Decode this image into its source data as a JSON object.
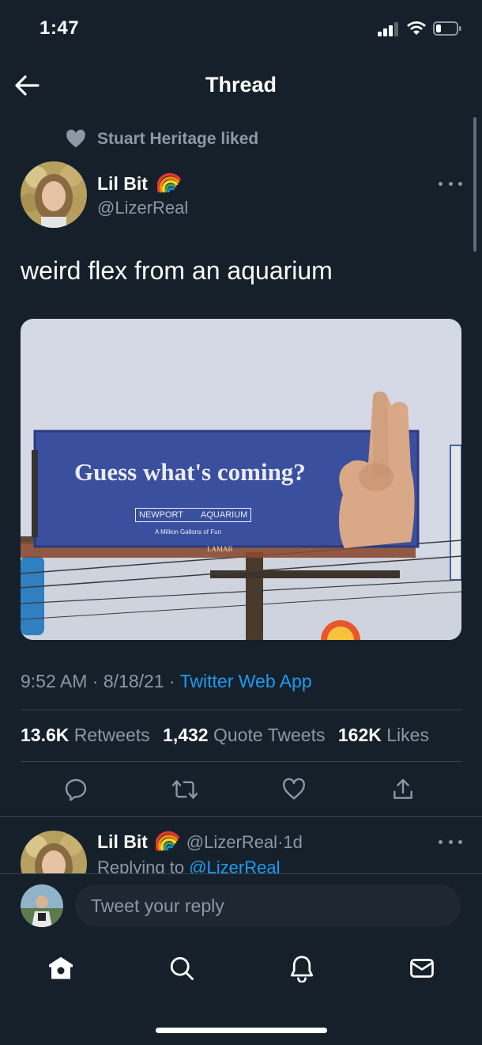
{
  "status_bar": {
    "time": "1:47"
  },
  "header": {
    "title": "Thread",
    "back_icon": "arrow-left-icon"
  },
  "social_context": {
    "text": "Stuart Heritage liked",
    "icon": "heart-icon"
  },
  "tweet": {
    "author_name": "Lil Bit",
    "author_handle": "@LizerReal",
    "text": "weird flex from an aquarium",
    "media": {
      "headline": "Guess what's coming?",
      "brand_left": "NEWPORT",
      "brand_right": "AQUARIUM",
      "tagline": "A Million Gallons of Fun",
      "operator": "LAMAR"
    },
    "time": "9:52 AM",
    "date": "8/18/21",
    "source": "Twitter Web App",
    "separator": "·",
    "stats": {
      "retweets_count": "13.6K",
      "retweets_label": "Retweets",
      "quotes_count": "1,432",
      "quotes_label": "Quote Tweets",
      "likes_count": "162K",
      "likes_label": "Likes"
    }
  },
  "reply_preview": {
    "author_name": "Lil Bit",
    "author_handle": "@LizerReal",
    "age": "1d",
    "replying_prefix": "Replying to",
    "replying_handle": "@LizerReal"
  },
  "compose": {
    "placeholder": "Tweet your reply"
  },
  "colors": {
    "background": "#15202b",
    "accent": "#1d9bf0",
    "muted": "#8b98a5",
    "divider": "#38444d"
  }
}
